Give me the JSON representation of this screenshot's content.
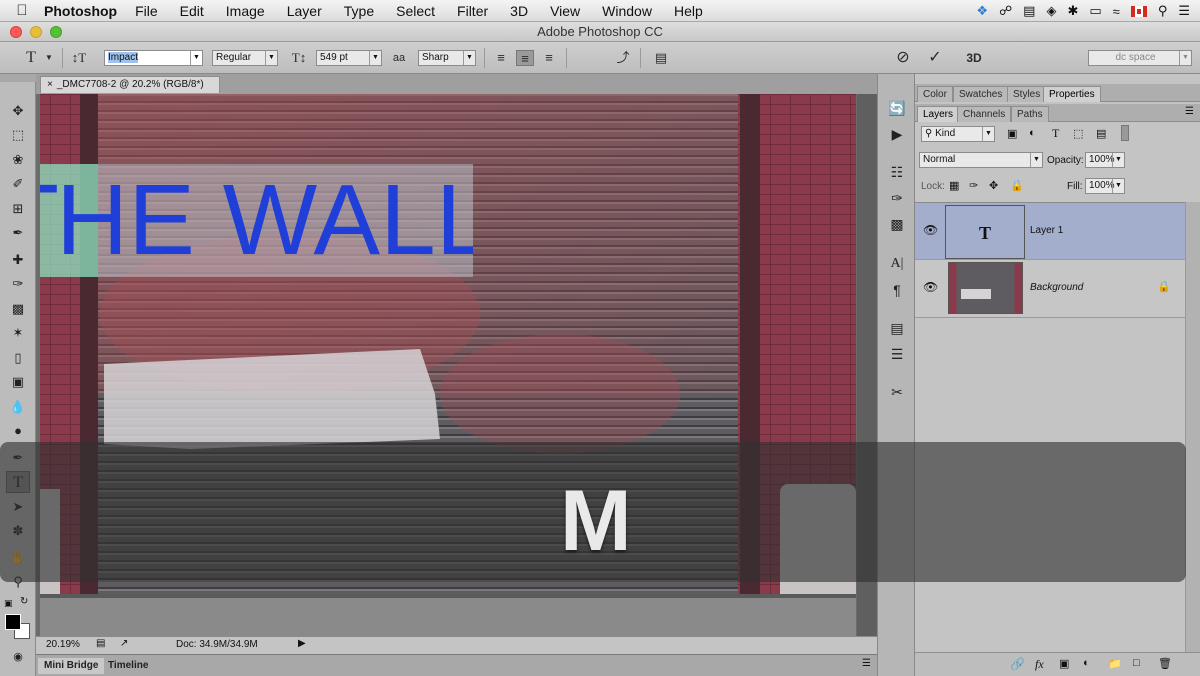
{
  "menubar": {
    "app_name": "Photoshop",
    "items": [
      "File",
      "Edit",
      "Image",
      "Layer",
      "Type",
      "Select",
      "Filter",
      "3D",
      "View",
      "Window",
      "Help"
    ]
  },
  "window": {
    "title": "Adobe Photoshop CC"
  },
  "options": {
    "font_family": "Impact",
    "font_style": "Regular",
    "font_size": "549 pt",
    "antialias_label": "a",
    "antialias": "Sharp",
    "color_swatch": "#e8c200",
    "workspace": "dc space"
  },
  "document": {
    "tab_title": "_DMC7708-2 @ 20.2% (RGB/8*)",
    "text_layer_content": "HE WALL",
    "text_partial_char": "T",
    "text_color": "#1f3fd8"
  },
  "status": {
    "zoom": "20.19%",
    "doc_info": "Doc: 34.9M/34.9M"
  },
  "bottom_tabs": [
    "Mini Bridge",
    "Timeline"
  ],
  "panels": {
    "top_tabs": [
      "Color",
      "Swatches",
      "Styles",
      "Properties"
    ],
    "layer_tabs": [
      "Layers",
      "Channels",
      "Paths"
    ],
    "filter_kind": "Kind",
    "blend_mode": "Normal",
    "opacity_label": "Opacity:",
    "opacity": "100%",
    "lock_label": "Lock:",
    "fill_label": "Fill:",
    "fill": "100%",
    "layers": [
      {
        "name": "Layer 1",
        "type": "text",
        "thumb_glyph": "T"
      },
      {
        "name": "Background",
        "type": "image"
      }
    ]
  },
  "hud": {
    "key": "M"
  }
}
